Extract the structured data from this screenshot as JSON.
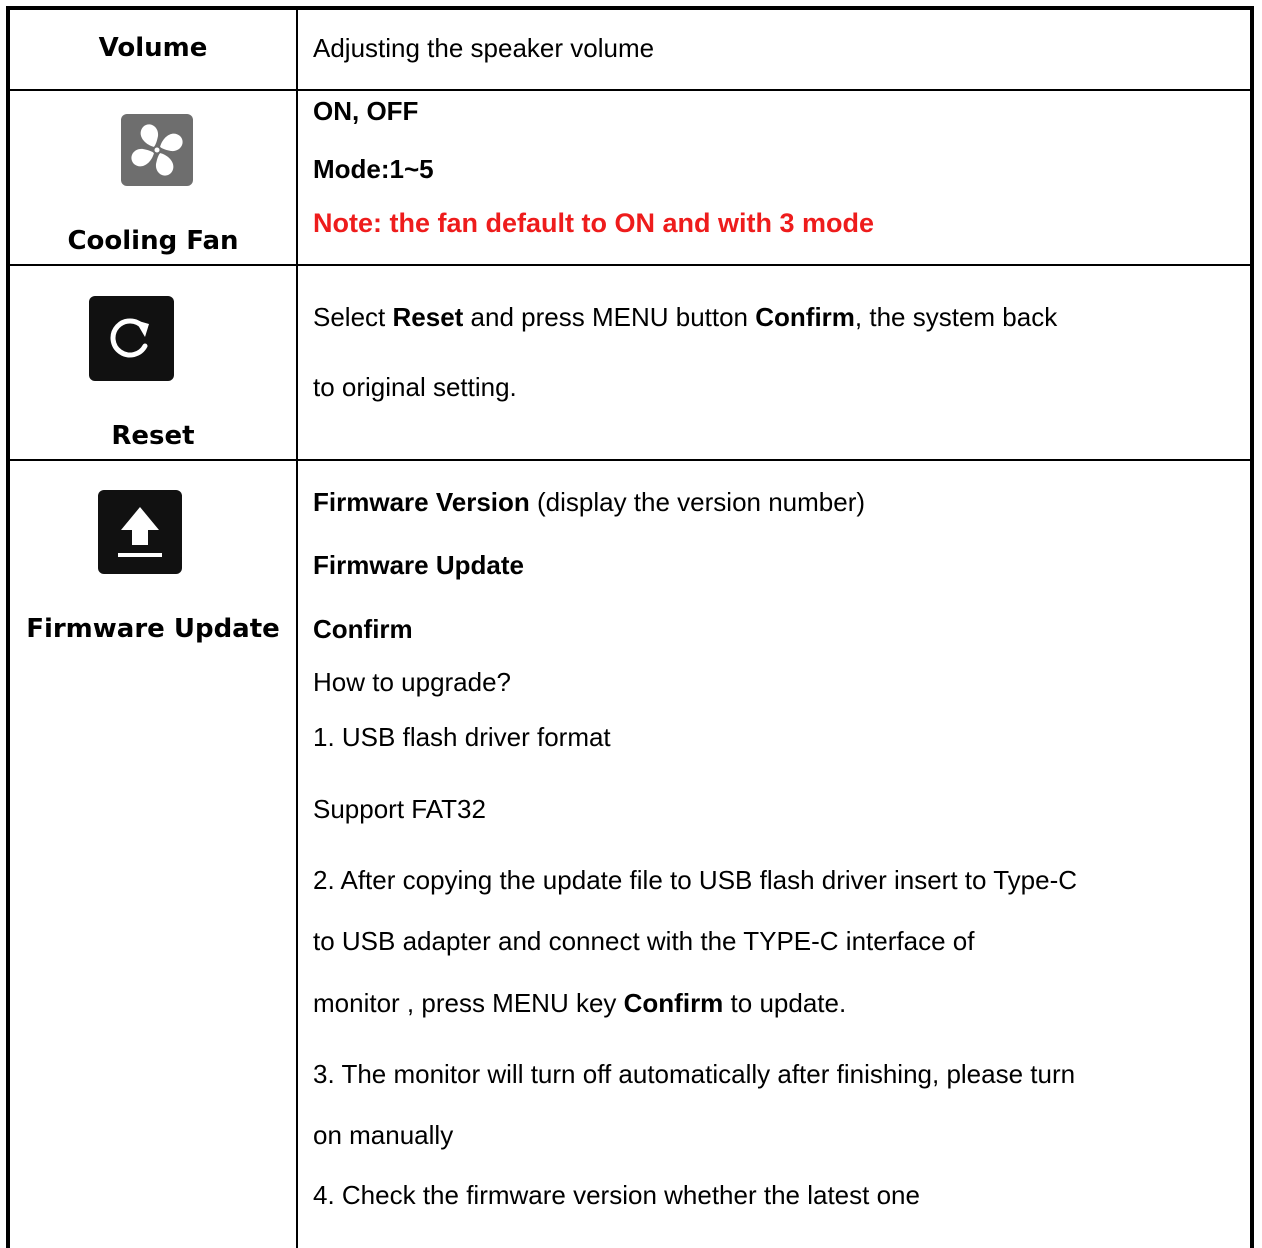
{
  "rows": {
    "volume": {
      "label": "Volume",
      "description": "Adjusting the speaker volume"
    },
    "cooling_fan": {
      "label": "Cooling Fan",
      "icon": "fan-icon",
      "line1": "ON, OFF",
      "line2": "Mode:1~5",
      "note": "Note: the fan default to ON and with 3 mode"
    },
    "reset": {
      "label": "Reset",
      "icon": "reset-icon",
      "line1_pre": "Select ",
      "line1_b1": "Reset",
      "line1_mid": " and press MENU button ",
      "line1_b2": "Confirm",
      "line1_post": ", the system back",
      "line2": "to original setting."
    },
    "firmware": {
      "label": "Firmware Update",
      "icon": "upload-icon",
      "version_b": "Firmware Version",
      "version_rest": " (display the version number)",
      "update_b": "Firmware Update",
      "confirm_b": "Confirm",
      "how": "How to upgrade?",
      "step1": "1. USB flash driver format",
      "support": "Support FAT32",
      "step2_l1": "2. After copying the update file to USB flash driver insert to Type-C",
      "step2_l2": "to USB adapter and connect with the TYPE-C interface of",
      "step2_l3_pre": "monitor , press MENU key ",
      "step2_l3_b": "Confirm",
      "step2_l3_post": " to update.",
      "step3_l1": "3. The monitor will turn off automatically after finishing, please turn",
      "step3_l2": "on manually",
      "step4": "4. Check the firmware version whether the latest one"
    }
  },
  "colors": {
    "note_red": "#ee1c1c",
    "fan_icon_bg": "#6e6e6e",
    "dark_icon_bg": "#111111"
  }
}
